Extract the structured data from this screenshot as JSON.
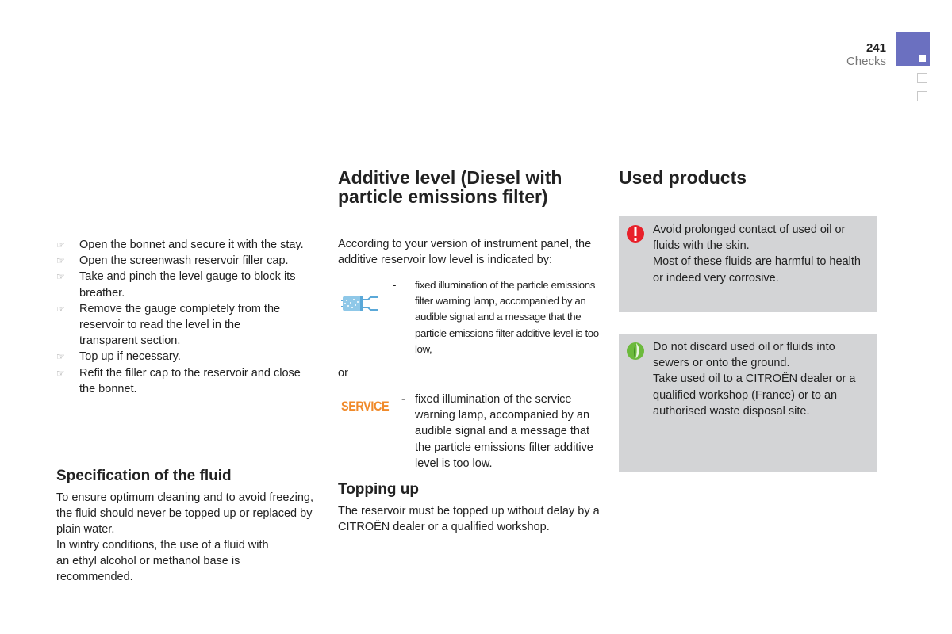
{
  "header": {
    "page_number": "241",
    "section": "Checks",
    "accent_color": "#6b70c0"
  },
  "column1": {
    "steps": [
      "Open the bonnet and secure it with the stay.",
      "Open the screenwash reservoir filler cap.",
      "Take and pinch the level gauge to block its breather.",
      "Remove the gauge completely from the reservoir to read the level in the transparent section.",
      "Top up if necessary.",
      "Refit the filler cap to the reservoir and close the bonnet."
    ],
    "bullet_icon": "pointing-hand-icon",
    "spec_title": "Specification of the fluid",
    "spec_text_1": "To ensure optimum cleaning and to avoid freezing, the fluid should never be topped up or replaced by plain water.",
    "spec_text_2": "In wintry conditions, the use of a fluid with an ethyl alcohol or methanol base is recommended."
  },
  "column2": {
    "title_line1": "Additive level (Diesel with",
    "title_line2": "particle emissions filter)",
    "intro": "According to your version of instrument panel, the additive reservoir low level is indicated by:",
    "indicator1": {
      "icon": "particle-filter-warning-icon",
      "dash": "-",
      "text": "fixed illumination of the particle emissions filter warning lamp, accompanied by an audible signal and a message that the particle emissions filter additive level is too low,"
    },
    "or_label": "or",
    "indicator2": {
      "icon_label": "SERVICE",
      "icon_color": "#f08a2a",
      "dash": "-",
      "text": "fixed illumination of the service warning lamp, accompanied by an audible signal and a message that the particle emissions filter additive level is too low."
    },
    "topping_title": "Topping up",
    "topping_text": "The reservoir must be topped up without delay by a CITROËN dealer or a qualified workshop."
  },
  "column3": {
    "title": "Used products",
    "warning_box": {
      "icon": "warning-exclamation-icon",
      "line1": "Avoid prolonged contact of used oil or fluids with the skin.",
      "line2": "Most of these fluids are harmful to health or indeed very corrosive."
    },
    "eco_box": {
      "icon": "eco-leaf-icon",
      "line1": "Do not discard used oil or fluids into sewers or onto the ground.",
      "line2": "Take used oil to a CITROËN dealer or a qualified workshop (France) or to an authorised waste disposal site."
    }
  }
}
